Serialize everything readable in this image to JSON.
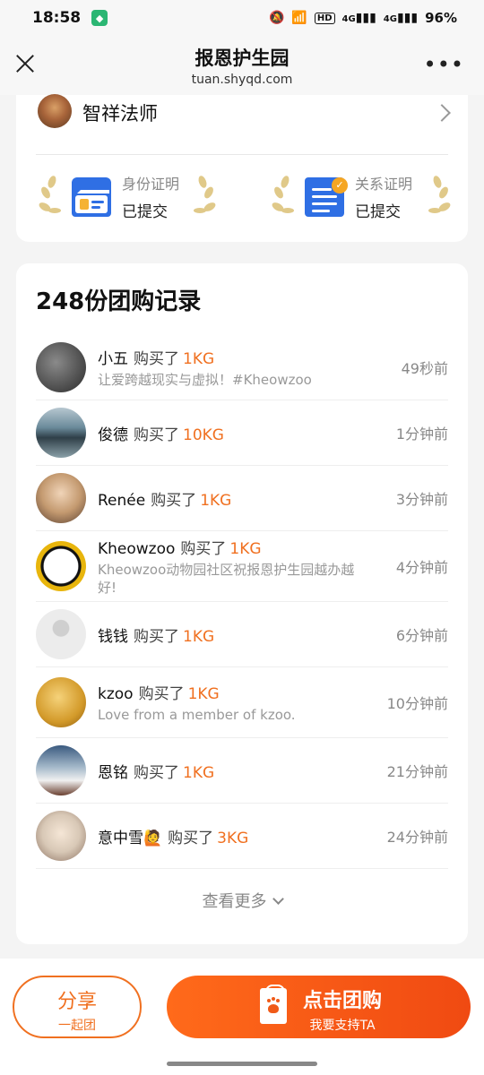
{
  "status": {
    "time": "18:58",
    "network1": "4G",
    "network2": "4G",
    "battery": "96%",
    "hd": "HD"
  },
  "nav": {
    "title": "报恩护生园",
    "url": "tuan.shyqd.com",
    "more": "•••"
  },
  "owner": {
    "name": "智祥法师"
  },
  "certs": [
    {
      "label": "身份证明",
      "value": "已提交",
      "icon": "id-card-icon"
    },
    {
      "label": "关系证明",
      "value": "已提交",
      "icon": "document-check-icon"
    }
  ],
  "records": {
    "title": "248份团购记录",
    "items": [
      {
        "name": "小五",
        "action": "购买了",
        "qty": "1KG",
        "msg": "让爱跨越现实与虚拟！#Kheowzoo",
        "time": "49秒前",
        "avatar": "#4a4a4a"
      },
      {
        "name": "俊德",
        "action": "购买了",
        "qty": "10KG",
        "msg": "",
        "time": "1分钟前",
        "avatar": "#5a7a90"
      },
      {
        "name": "Renée",
        "action": "购买了",
        "qty": "1KG",
        "msg": "",
        "time": "3分钟前",
        "avatar": "#c7a07a"
      },
      {
        "name": "Kheowzoo",
        "action": "购买了",
        "qty": "1KG",
        "msg": "Kheowzoo动物园社区祝报恩护生园越办越好!",
        "time": "4分钟前",
        "avatar": "#e8b50c"
      },
      {
        "name": "钱钱",
        "action": "购买了",
        "qty": "1KG",
        "msg": "",
        "time": "6分钟前",
        "avatar": "#e6e6e6"
      },
      {
        "name": "kzoo",
        "action": "购买了",
        "qty": "1KG",
        "msg": "Love from a member of kzoo.",
        "time": "10分钟前",
        "avatar": "#d39a2a"
      },
      {
        "name": "恩铭",
        "action": "购买了",
        "qty": "1KG",
        "msg": "",
        "time": "21分钟前",
        "avatar": "#6a8fb0"
      },
      {
        "name": "意中雪🙋",
        "action": "购买了",
        "qty": "3KG",
        "msg": "",
        "time": "24分钟前",
        "avatar": "#d8c8b6"
      }
    ],
    "see_more": "查看更多"
  },
  "bottom": {
    "share_label": "分享",
    "share_sub": "一起团",
    "buy_label": "点击团购",
    "buy_sub": "我要支持TA"
  }
}
